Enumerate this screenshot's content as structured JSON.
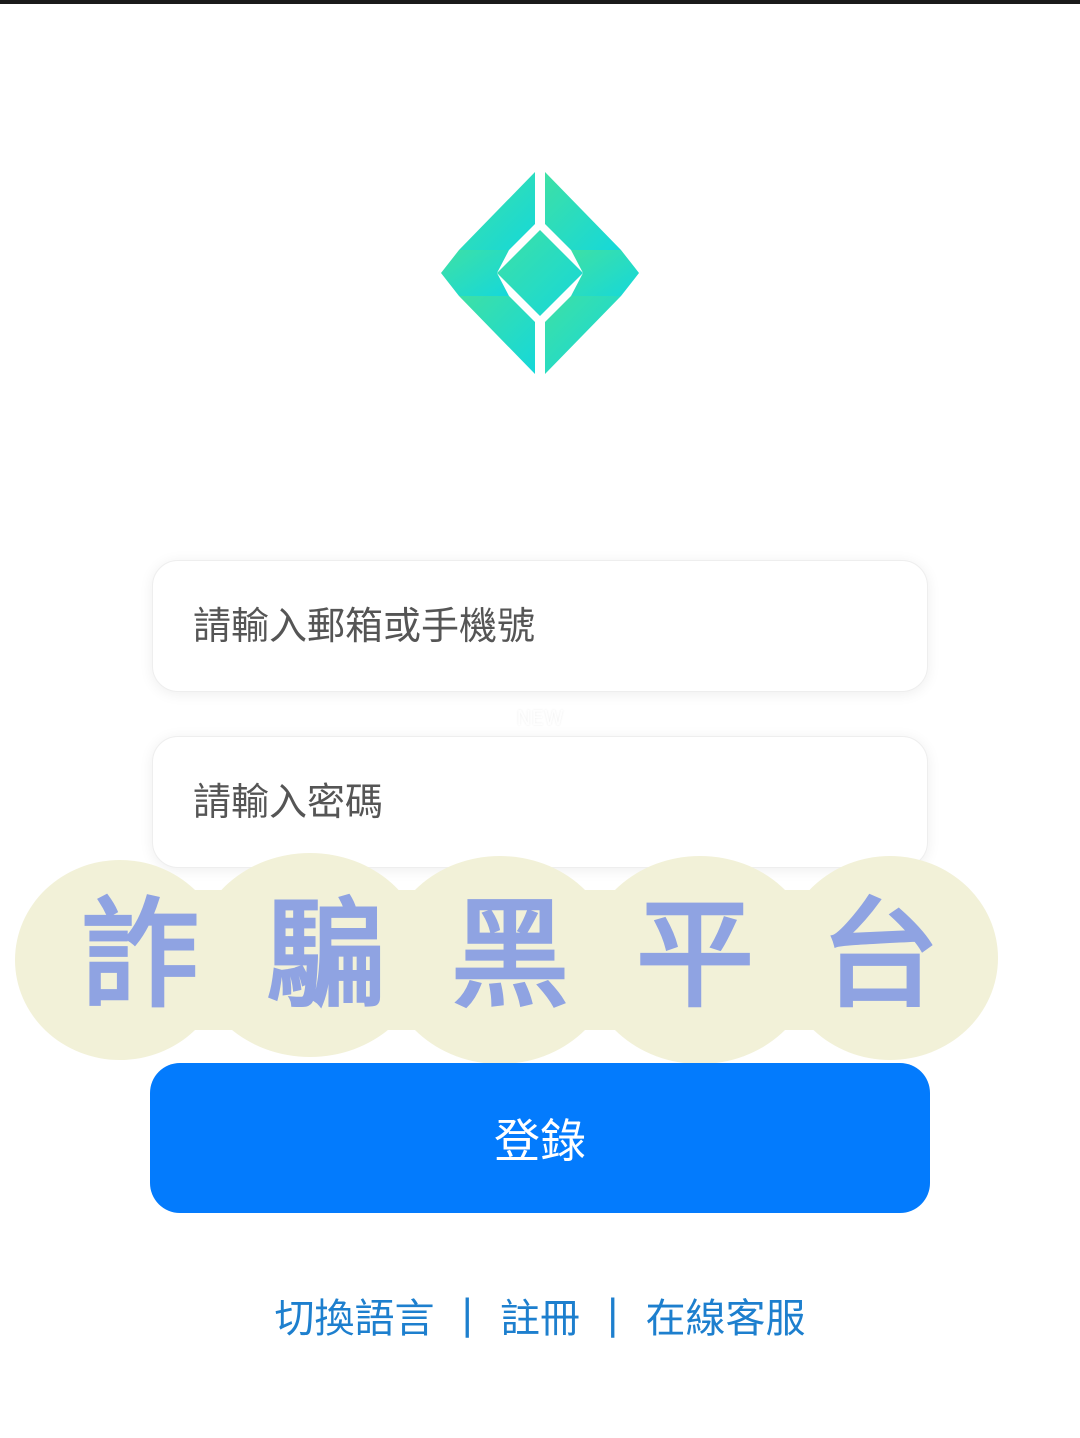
{
  "form": {
    "email_placeholder": "請輸入郵箱或手機號",
    "password_placeholder": "請輸入密碼"
  },
  "login_button": {
    "label": "登錄"
  },
  "footer": {
    "switch_language": "切換語言",
    "register": "註冊",
    "support": "在線客服",
    "separator": "|"
  },
  "overlay": {
    "warning_stamp": [
      "詐",
      "騙",
      "黑",
      "平",
      "台"
    ],
    "small_watermark": "NEW"
  },
  "colors": {
    "logo_gradient_start": "#3ee0a5",
    "logo_gradient_end": "#15d8da",
    "button": "#037bfd",
    "link": "#1d7fce",
    "stamp_background": "#f2f1d8",
    "stamp_text": "#8fa3e2"
  },
  "icons": {
    "logo": "diamond-logo-icon"
  }
}
